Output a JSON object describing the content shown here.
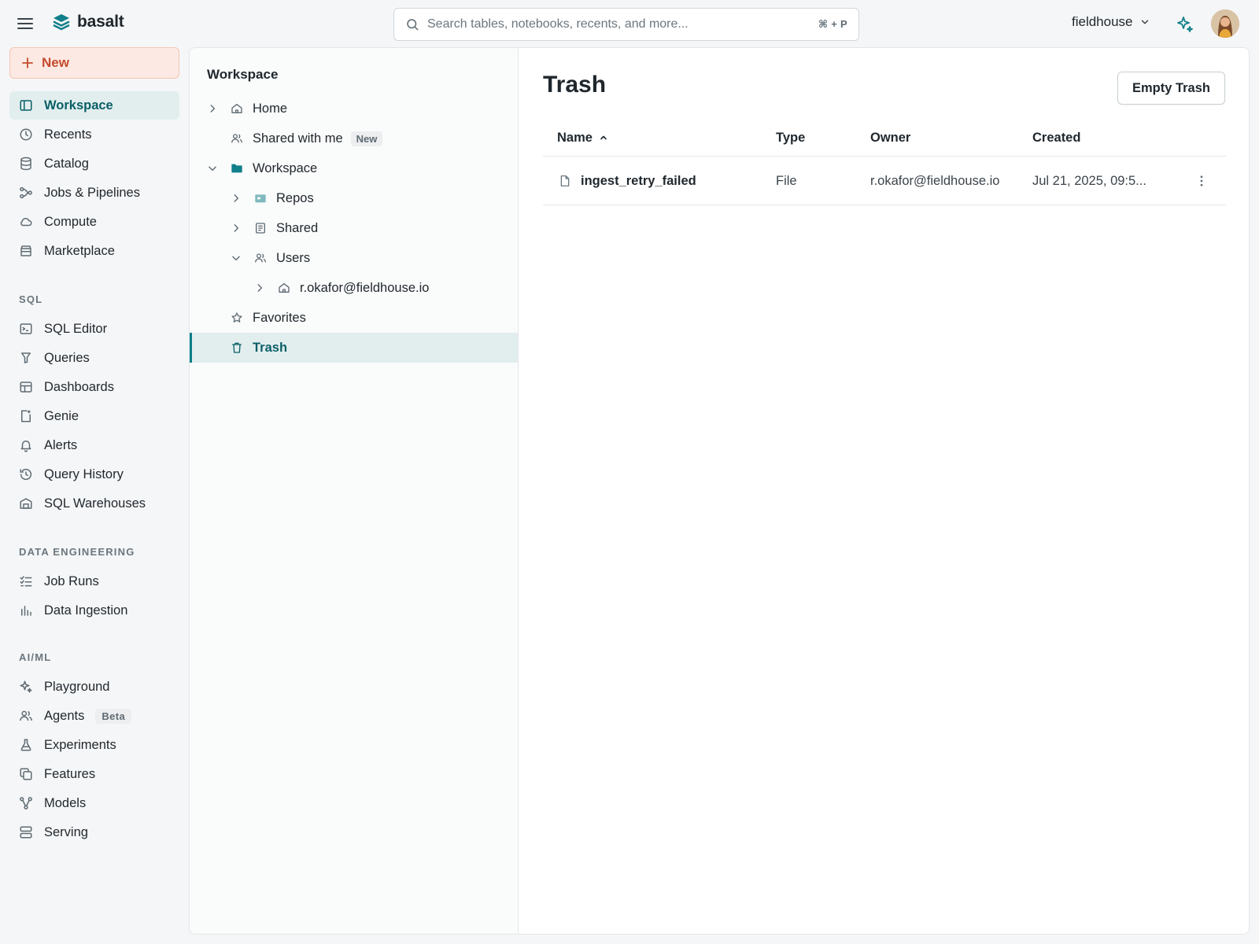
{
  "brand": {
    "name": "basalt",
    "accent": "#0f7f8a"
  },
  "search": {
    "placeholder": "Search tables, notebooks, recents, and more...",
    "shortcut": "⌘ + P"
  },
  "workspace_switcher": {
    "label": "fieldhouse"
  },
  "nav": {
    "new_label": "New",
    "primary": [
      {
        "label": "Workspace",
        "icon": "sidebar-icon",
        "active": true
      },
      {
        "label": "Recents",
        "icon": "clock-icon"
      },
      {
        "label": "Catalog",
        "icon": "database-icon"
      },
      {
        "label": "Jobs & Pipelines",
        "icon": "workflow-icon"
      },
      {
        "label": "Compute",
        "icon": "cloud-icon"
      },
      {
        "label": "Marketplace",
        "icon": "store-icon"
      }
    ],
    "sql_label": "SQL",
    "sql": [
      {
        "label": "SQL Editor",
        "icon": "terminal-icon"
      },
      {
        "label": "Queries",
        "icon": "filter-icon"
      },
      {
        "label": "Dashboards",
        "icon": "dashboard-icon"
      },
      {
        "label": "Genie",
        "icon": "genie-icon"
      },
      {
        "label": "Alerts",
        "icon": "bell-icon"
      },
      {
        "label": "Query History",
        "icon": "history-icon"
      },
      {
        "label": "SQL Warehouses",
        "icon": "warehouse-icon"
      }
    ],
    "de_label": "DATA ENGINEERING",
    "de": [
      {
        "label": "Job Runs",
        "icon": "list-check-icon"
      },
      {
        "label": "Data Ingestion",
        "icon": "bar-chart-icon"
      }
    ],
    "aiml_label": "AI/ML",
    "aiml": [
      {
        "label": "Playground",
        "icon": "sparkle-icon"
      },
      {
        "label": "Agents",
        "icon": "users-icon",
        "badge": "Beta"
      },
      {
        "label": "Experiments",
        "icon": "flask-icon"
      },
      {
        "label": "Features",
        "icon": "copy-icon"
      },
      {
        "label": "Models",
        "icon": "model-icon"
      },
      {
        "label": "Serving",
        "icon": "server-icon"
      }
    ]
  },
  "tree": {
    "title": "Workspace",
    "items": [
      {
        "label": "Home",
        "icon": "home-icon",
        "chevron": "right",
        "depth": 0
      },
      {
        "label": "Shared with me",
        "icon": "users-icon",
        "chevron": "none",
        "depth": 0,
        "badge": "New"
      },
      {
        "label": "Workspace",
        "icon": "folder-icon",
        "chevron": "down",
        "depth": 0
      },
      {
        "label": "Repos",
        "icon": "repo-icon",
        "chevron": "right",
        "depth": 1
      },
      {
        "label": "Shared",
        "icon": "document-icon",
        "chevron": "right",
        "depth": 1
      },
      {
        "label": "Users",
        "icon": "users-icon",
        "chevron": "down",
        "depth": 1
      },
      {
        "label": "r.okafor@fieldhouse.io",
        "icon": "home-icon",
        "chevron": "right",
        "depth": 2
      },
      {
        "label": "Favorites",
        "icon": "star-icon",
        "chevron": "none",
        "depth": 0
      },
      {
        "label": "Trash",
        "icon": "trash-icon",
        "chevron": "none",
        "depth": 0,
        "active": true
      }
    ]
  },
  "main": {
    "title": "Trash",
    "empty_button": "Empty Trash",
    "columns": {
      "name": "Name",
      "type": "Type",
      "owner": "Owner",
      "created": "Created"
    },
    "rows": [
      {
        "name": "ingest_retry_failed",
        "type": "File",
        "owner": "r.okafor@fieldhouse.io",
        "created": "Jul 21, 2025, 09:5..."
      }
    ]
  }
}
